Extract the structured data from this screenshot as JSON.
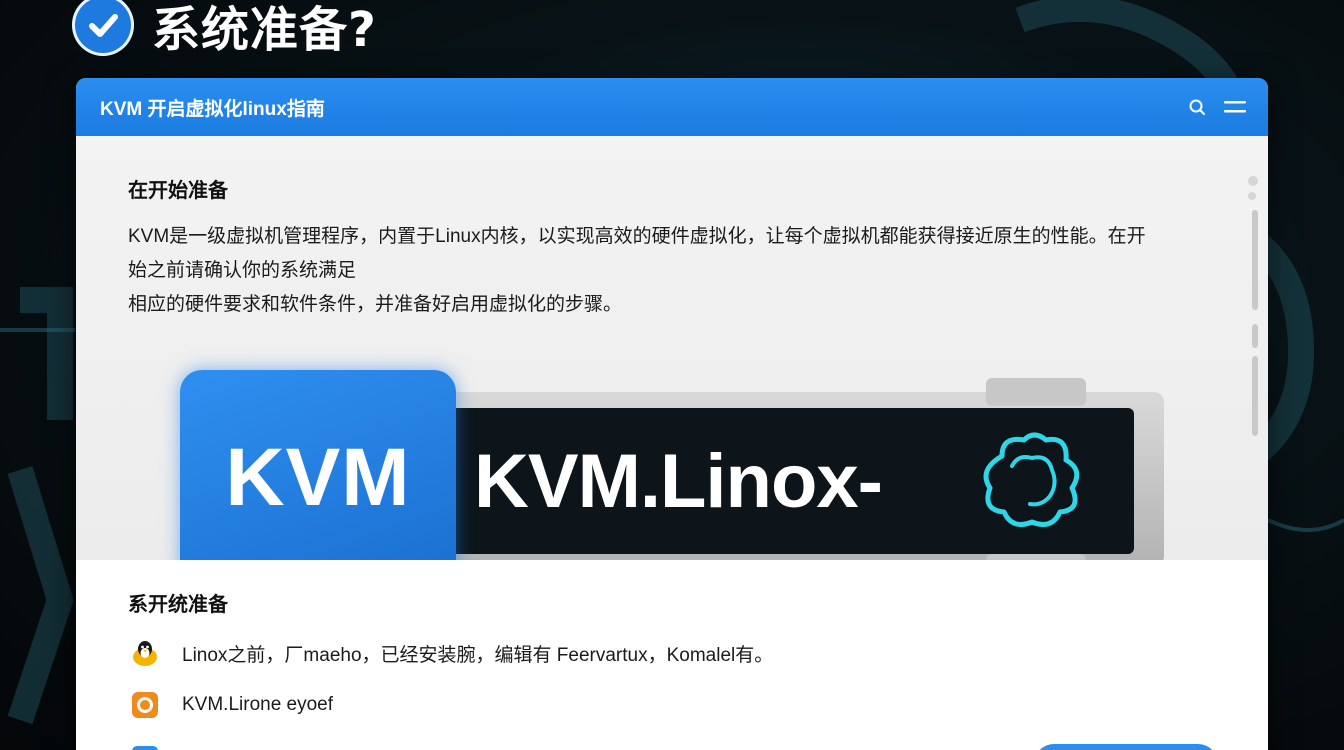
{
  "heading": {
    "text": "系统准备?",
    "icon": "check-circle-icon"
  },
  "window": {
    "title": "KVM 开启虚拟化linux指南",
    "search_icon": "search-icon",
    "menu_icon": "hamburger-menu-icon"
  },
  "section1": {
    "title": "在开始准备",
    "description_line1": "KVM是一级虚拟机管理程序，内置于Linux内核，以实现高效的硬件虚拟化，让每个虚拟机都能获得接近原生的性能。在开始之前请确认你的系统满足",
    "description_line2": "相应的硬件要求和软件条件，并准备好启用虚拟化的步骤。"
  },
  "banner": {
    "left_label": "KVM",
    "right_label": "KVM.Linox-",
    "icon": "cloud-outline-icon"
  },
  "section2": {
    "title": "系开统准备",
    "items": [
      {
        "text": "Linox之前，厂maeho，已经安装腕，编辑有 Feervartux，Komalel有。",
        "icon": "linux-penguin-icon"
      },
      {
        "text": "KVM.Lirone eyoef",
        "icon": "orange-app-icon"
      },
      {
        "text": "",
        "icon": "blue-square-icon"
      }
    ]
  },
  "colors": {
    "accent": "#1f7ae0",
    "titlebar": "#2a8ef0",
    "banner_screen": "#0d151a",
    "cloud_stroke": "#2fd6e8",
    "linux_icon": "#f5b400",
    "orange_icon": "#f08a1c"
  }
}
